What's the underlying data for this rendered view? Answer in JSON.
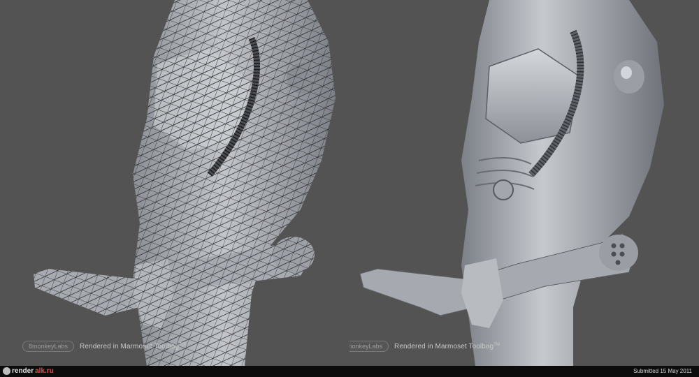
{
  "left_panel": {
    "render": "wireframe",
    "description_label": ""
  },
  "right_panel": {
    "render": "shaded"
  },
  "watermark": {
    "logo_text": "8monkeyLabs",
    "caption": "Rendered in Marmoset Toolbag",
    "tm": "TM"
  },
  "footer": {
    "site_name": "render",
    "site_tld": "alk.ru",
    "submitted": "Submitted 15 May 2011"
  },
  "colors": {
    "background": "#535353",
    "model_light": "#b9bcc2",
    "model_dark": "#6e7178",
    "wire": "#1b1b1b",
    "footer_bar": "#0c0c0c",
    "site_accent": "#e54b4b"
  }
}
